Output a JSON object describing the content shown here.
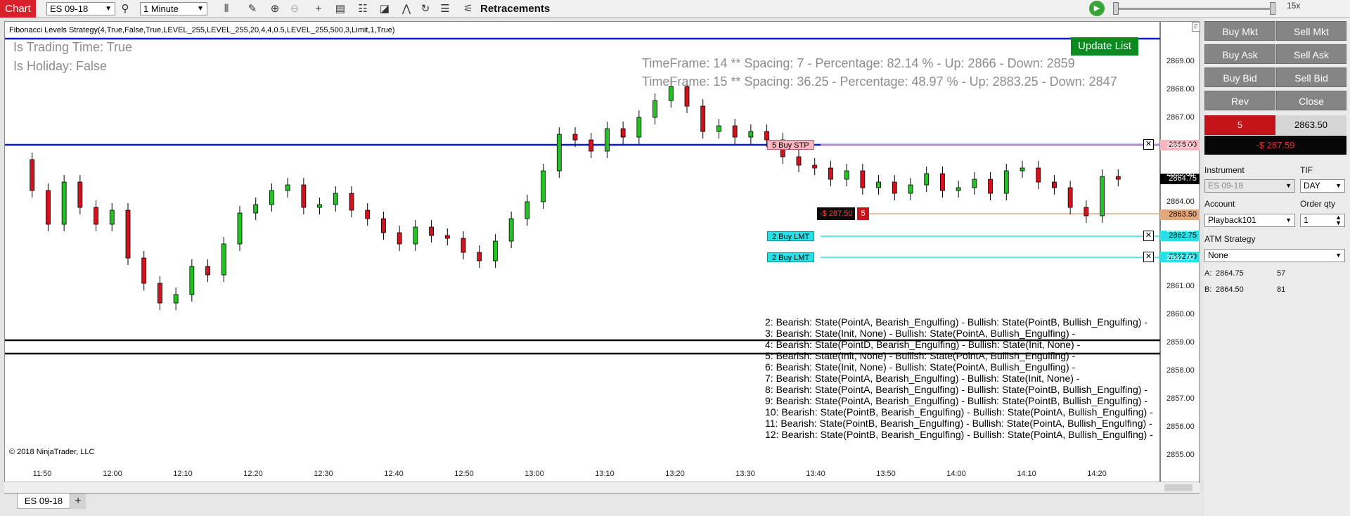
{
  "toolbar": {
    "chart_tab": "Chart",
    "instrument": "ES 09-18",
    "interval": "1 Minute",
    "retracements_label": "Retracements",
    "playback_speed": "15x"
  },
  "chart": {
    "indicator_title": "Fibonacci Levels Strategy(4,True,False,True,LEVEL_255,LEVEL_255,20,4,4,0.5,LEVEL_255,500,3,Limit,1,True)",
    "is_trading_time": "Is Trading Time: True",
    "is_holiday": "Is Holiday: False",
    "timeframe_lines": [
      "TimeFrame: 14 ** Spacing: 7 - Percentage: 82.14 % - Up: 2866 - Down: 2859",
      "TimeFrame: 15 ** Spacing: 36.25 - Percentage: 48.97 % - Up: 2883.25 - Down: 2847"
    ],
    "update_list_button": "Update List",
    "state_lines": [
      "2: Bearish: State(PointA, Bearish_Engulfing) - Bullish: State(PointB, Bullish_Engulfing) -",
      "3: Bearish: State(Init, None) - Bullish: State(PointA, Bullish_Engulfing) -",
      "4: Bearish: State(PointD, Bearish_Engulfing) - Bullish: State(Init, None) -",
      "5: Bearish: State(Init, None) - Bullish: State(PointA, Bullish_Engulfing) -",
      "6: Bearish: State(Init, None) - Bullish: State(PointA, Bullish_Engulfing) -",
      "7: Bearish: State(PointA, Bearish_Engulfing) - Bullish: State(Init, None) -",
      "8: Bearish: State(PointA, Bearish_Engulfing) - Bullish: State(PointB, Bullish_Engulfing) -",
      "9: Bearish: State(PointA, Bearish_Engulfing) - Bullish: State(PointB, Bullish_Engulfing) -",
      "10: Bearish: State(PointB, Bearish_Engulfing) - Bullish: State(PointA, Bullish_Engulfing) -",
      "11: Bearish: State(PointB, Bearish_Engulfing) - Bullish: State(PointA, Bullish_Engulfing) -",
      "12: Bearish: State(PointB, Bearish_Engulfing) - Bullish: State(PointA, Bullish_Engulfing) -"
    ],
    "copyright": "© 2018 NinjaTrader, LLC",
    "y_axis_labels": [
      "2869.00",
      "2868.00",
      "2867.00",
      "2866.00",
      "2865.00",
      "2864.00",
      "2863.00",
      "2862.00",
      "2861.00",
      "2860.00",
      "2859.00",
      "2858.00",
      "2857.00",
      "2856.00",
      "2855.00"
    ],
    "x_axis_labels": [
      "11:50",
      "12:00",
      "12:10",
      "12:20",
      "12:30",
      "12:40",
      "12:50",
      "13:00",
      "13:10",
      "13:20",
      "13:30",
      "13:40",
      "13:50",
      "14:00",
      "14:10",
      "14:20"
    ],
    "orders": [
      {
        "label": "5  Buy STP",
        "price_tag": "2866.00"
      },
      {
        "label": "2  Buy LMT",
        "price_tag": "2862.75"
      },
      {
        "label": "2  Buy LMT",
        "price_tag": "2862.00"
      }
    ],
    "position": {
      "pnl": "-$ 287.50",
      "qty": "5",
      "price_tag": "2863.50"
    },
    "last_price": "2864.75",
    "colors": {
      "up_candle": "#22c322",
      "down_candle": "#d4121e",
      "fib_blue": "#0a1ad0",
      "fib_black": "#000000",
      "order_cyan": "#28e0e6",
      "stop_pink": "#f7b6c0",
      "position_orange": "#e3a87c"
    }
  },
  "tabs": {
    "active": "ES 09-18",
    "add": "+"
  },
  "order_panel": {
    "buttons": [
      "Buy Mkt",
      "Sell Mkt",
      "Buy Ask",
      "Sell Ask",
      "Buy Bid",
      "Sell Bid",
      "Rev",
      "Close"
    ],
    "position_qty": "5",
    "avg_price": "2863.50",
    "unrealized_pnl": "-$ 287.59",
    "instrument_label": "Instrument",
    "instrument_value": "ES 09-18",
    "tif_label": "TIF",
    "tif_value": "DAY",
    "account_label": "Account",
    "account_value": "Playback101",
    "order_qty_label": "Order qty",
    "order_qty_value": "1",
    "atm_label": "ATM Strategy",
    "atm_value": "None",
    "ask_label": "A:",
    "ask_price": "2864.75",
    "ask_size": "57",
    "bid_label": "B:",
    "bid_price": "2864.50",
    "bid_size": "81"
  }
}
